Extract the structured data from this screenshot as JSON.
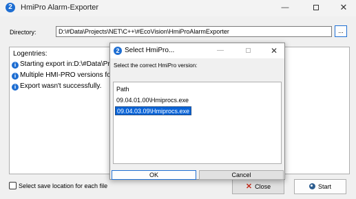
{
  "window": {
    "title": "HmiPro Alarm-Exporter",
    "app_icon_glyph": "2",
    "min_glyph": "—",
    "close_glyph": "✕"
  },
  "directory": {
    "label": "Directory:",
    "value": "D:\\#Data\\Projects\\NET\\C++\\#EcoVision\\HmiProAlarmExporter",
    "browse_label": "..."
  },
  "log": {
    "title": "Logentries:",
    "entries": [
      "Starting export in:D:\\#Data\\Pro",
      "Multiple HMI-PRO versions fou",
      "Export wasn't successfully."
    ],
    "info_glyph": "i"
  },
  "save_location": {
    "label": "Select save location for each file",
    "checked": false
  },
  "buttons": {
    "close_label": "Close",
    "close_glyph": "✕",
    "start_label": "Start"
  },
  "dialog": {
    "title": "Select HmiPro...",
    "icon_glyph": "2",
    "min_glyph": "—",
    "close_glyph": "✕",
    "prompt": "Select the correct HmiPro version:",
    "list_header": "Path",
    "items": [
      "09.04.01.00\\Hmiprocs.exe",
      "09.04.03.09\\Hmiprocs.exe"
    ],
    "selected_index": 1,
    "ok_label": "OK",
    "cancel_label": "Cancel"
  },
  "colors": {
    "accent": "#1e6ed2",
    "selection": "#0a64d8",
    "close_red": "#c42b1c"
  }
}
